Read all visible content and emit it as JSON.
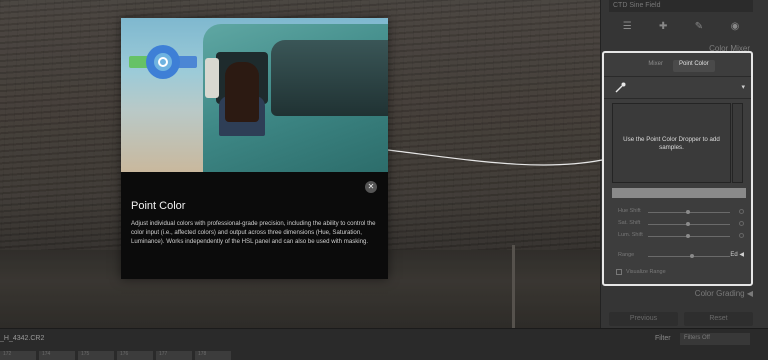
{
  "window": {
    "filename": "_H_4342.CR2"
  },
  "promo": {
    "title": "Point Color",
    "body": "Adjust individual colors with professional-grade precision, including the ability to control the color input (i.e., affected colors) and output across three dimensions (Hue, Saturation, Luminance). Works independently of the HSL panel and can also be used with masking.",
    "close_label": "✕",
    "swatch_colors": {
      "green": "#66c266",
      "blue": "#4c86d4",
      "ring": "#3e7fd6"
    }
  },
  "right_panel": {
    "top_field": "CTD Sine Field",
    "collapsed_title": "Color Mixer",
    "tabs": [
      {
        "label": "Mixer",
        "active": false
      },
      {
        "label": "Point Color",
        "active": true
      }
    ],
    "dropdown_caret": "▾",
    "samples_text": "Use the Point Color Dropper to add samples.",
    "sliders": [
      {
        "label": "Hue Shift",
        "value": 0
      },
      {
        "label": "Sat. Shift",
        "value": 0
      },
      {
        "label": "Lum. Shift",
        "value": 0
      }
    ],
    "range": {
      "label": "Range",
      "value_text": "Ed"
    },
    "visualize": {
      "label": "Visualize Range"
    },
    "color_grading": "Color Grading",
    "buttons": [
      "Previous",
      "Reset"
    ]
  },
  "bottom_bar": {
    "filter_label": "Filter",
    "filter_value": "Filters Off",
    "thumbnails": [
      "172",
      "174",
      "175",
      "176",
      "177",
      "178"
    ]
  },
  "accent_color": "#e6e6e6"
}
